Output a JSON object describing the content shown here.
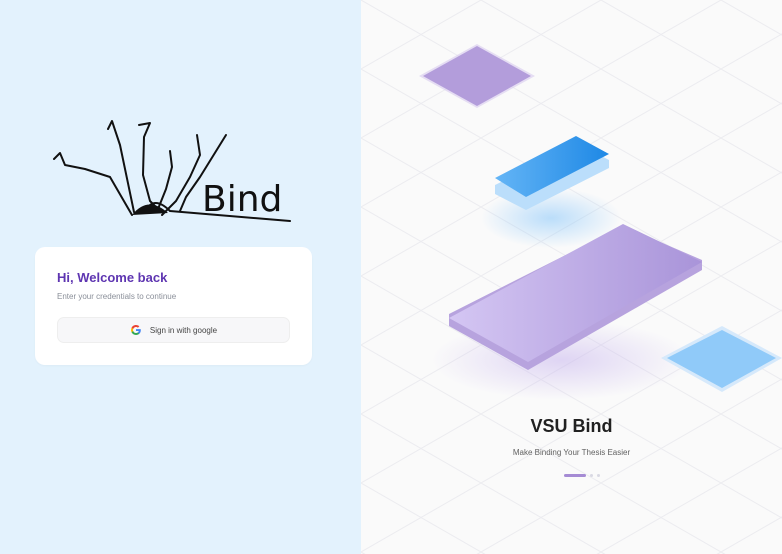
{
  "logo": {
    "text": "Bind"
  },
  "card": {
    "title": "Hi, Welcome back",
    "subtitle": "Enter your credentials to continue",
    "google_button_label": "Sign in with google",
    "google_icon": "google-g-icon"
  },
  "hero": {
    "title": "VSU Bind",
    "subtitle": "Make Binding Your Thesis Easier",
    "carousel": {
      "slides": 3,
      "active": 0
    }
  },
  "colors": {
    "left_bg": "#e3f2fd",
    "accent": "#5e35b1",
    "purple_shape": "#b39ddb",
    "blue_shape": "#90caf9",
    "blue_accent": "#2196f3"
  }
}
